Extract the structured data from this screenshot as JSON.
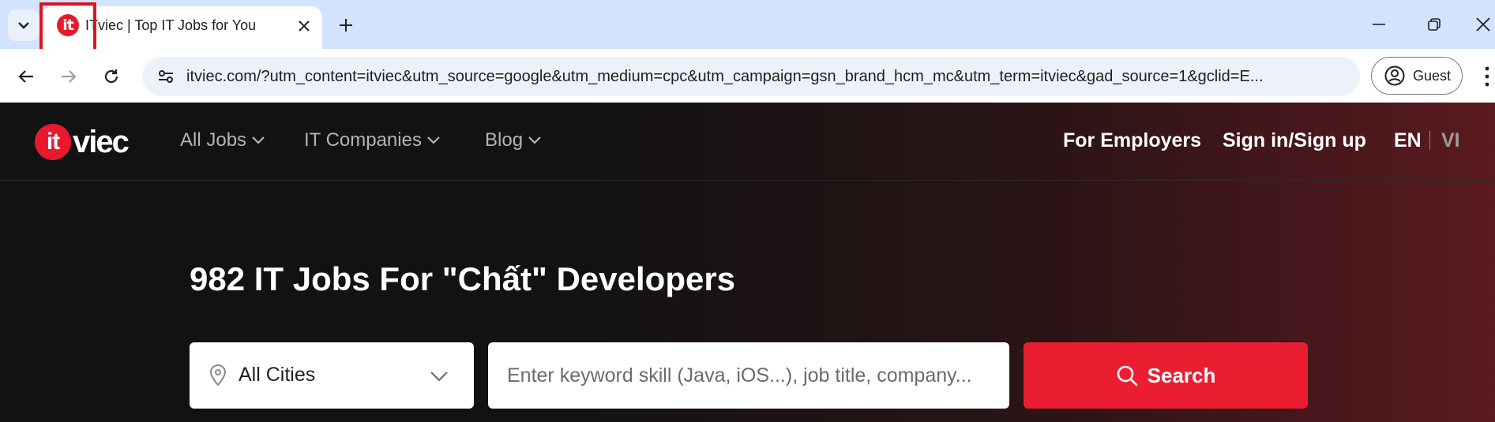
{
  "browser": {
    "tab": {
      "title": "ITviec | Top IT Jobs for You",
      "favicon": "it"
    },
    "url": "itviec.com/?utm_content=itviec&utm_source=google&utm_medium=cpc&utm_campaign=gsn_brand_hcm_mc&utm_term=itviec&gad_source=1&gclid=E...",
    "profile_label": "Guest"
  },
  "site": {
    "logo_it": "it",
    "logo_viec": "viec",
    "nav": [
      {
        "label": "All Jobs"
      },
      {
        "label": "IT Companies"
      },
      {
        "label": "Blog"
      }
    ],
    "for_employers": "For Employers",
    "sign_in": "Sign in/Sign up",
    "lang_en": "EN",
    "lang_vi": "VI"
  },
  "hero": {
    "headline": "982 IT Jobs For \"Chất\" Developers",
    "city_value": "All Cities",
    "keyword_placeholder": "Enter keyword skill (Java, iOS...), job title, company...",
    "search_label": "Search"
  },
  "colors": {
    "accent": "#ea1e30",
    "tabstrip": "#d3e3fd",
    "highlight": "#e0141e"
  }
}
